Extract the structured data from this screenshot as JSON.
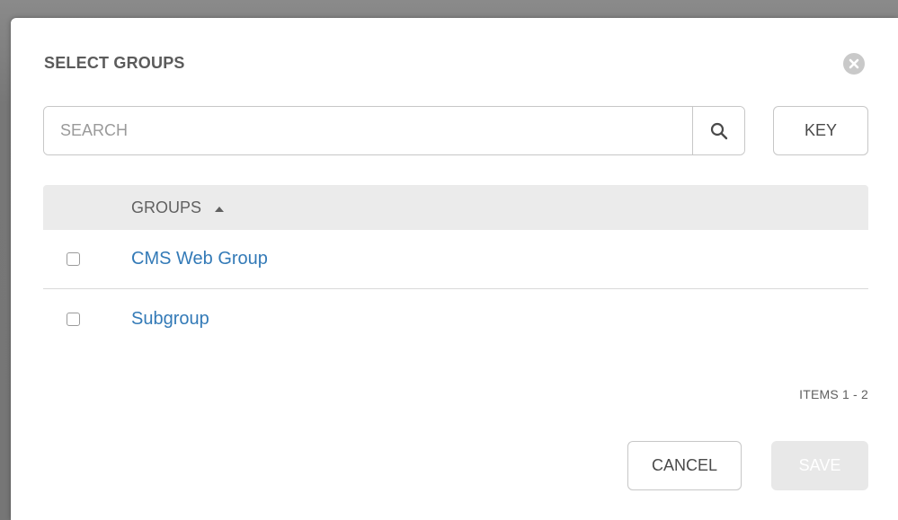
{
  "modal": {
    "title": "SELECT GROUPS",
    "close_icon": "close-circle-icon"
  },
  "search": {
    "placeholder": "SEARCH",
    "value": "",
    "icon": "search-icon",
    "key_label": "KEY"
  },
  "table": {
    "column_header": "GROUPS",
    "sort_icon": "sort-ascending-icon",
    "rows": [
      {
        "label": "CMS Web Group",
        "checked": false
      },
      {
        "label": "Subgroup",
        "checked": false
      }
    ]
  },
  "pagination": {
    "text": "ITEMS  1 - 2"
  },
  "footer": {
    "cancel_label": "CANCEL",
    "save_label": "SAVE"
  },
  "colors": {
    "link": "#337ab7",
    "header_bg": "#ebebeb",
    "disabled_button_bg": "#e8e8e8"
  }
}
